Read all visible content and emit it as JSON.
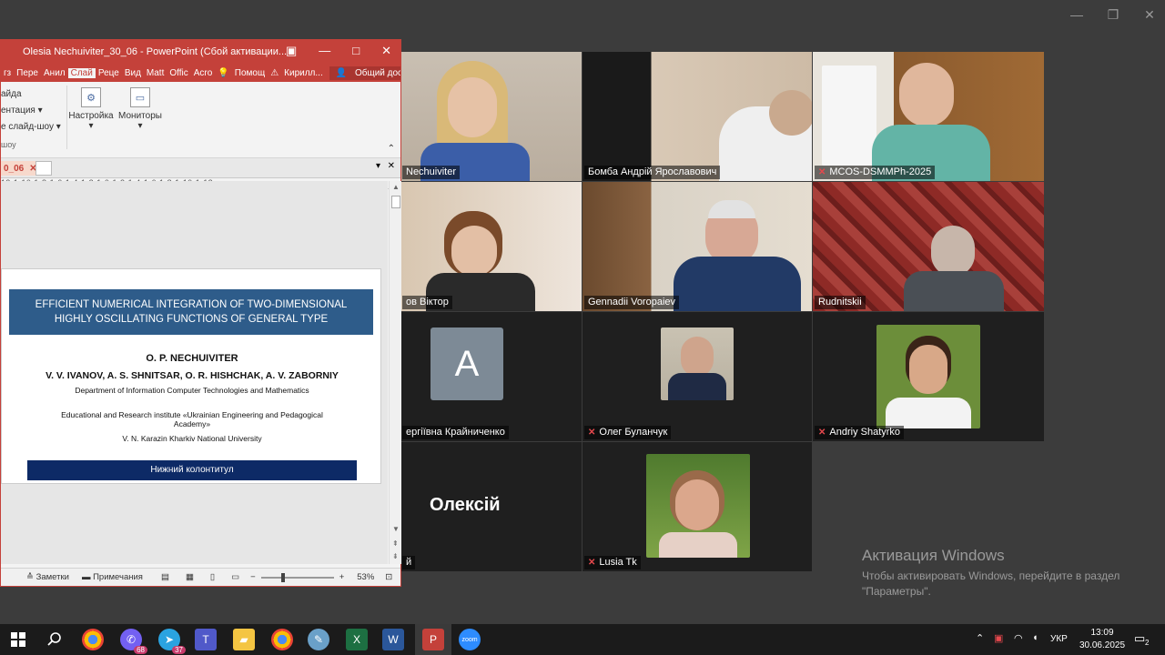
{
  "zoom_window": {
    "controls": [
      "—",
      "❐",
      "✕"
    ]
  },
  "participants": [
    {
      "id": "p1",
      "name": "Nechuiviter",
      "muted": false
    },
    {
      "id": "p2",
      "name": "Бомба Андрій Ярославович",
      "muted": false
    },
    {
      "id": "p3",
      "name": "MCOS-DSMMPh-2025",
      "muted": true
    },
    {
      "id": "p4",
      "name": "ов Віктор",
      "muted": false
    },
    {
      "id": "p5",
      "name": "Gennadii Voropaiev",
      "muted": false,
      "active_speaker": true
    },
    {
      "id": "p6",
      "name": "Rudnitskii",
      "muted": false
    },
    {
      "id": "p7",
      "name": "ергіївна Крайниченко",
      "muted": false,
      "avatar_letter": "A"
    },
    {
      "id": "p8",
      "name": "Олег Буланчук",
      "muted": true
    },
    {
      "id": "p9",
      "name": "Andriy Shatyrko",
      "muted": true
    },
    {
      "id": "p10",
      "name": "й",
      "muted": false,
      "display_name_big": "Олексій"
    },
    {
      "id": "p11",
      "name": "Lusia Tk",
      "muted": true
    }
  ],
  "powerpoint": {
    "title": "Olesia Nechuiviter_30_06 - PowerPoint (Сбой активации...",
    "tabs": [
      "гз",
      "Пере",
      "Анил",
      "Слай",
      "Реце",
      "Вид",
      "Matt",
      "Offic",
      "Acro"
    ],
    "selected_tab": "Слай",
    "help": "Помощ",
    "warning": "Кирилл...",
    "share": "Общий доступ",
    "ribbon": {
      "left_items": [
        "айда",
        "ентация",
        "е слайд-шоу"
      ],
      "group_label": "шоу",
      "setup": "Настройка",
      "monitors": "Мониторы"
    },
    "doc_tab": "0_06",
    "ruler": "12·1·10·1·8·1·6·1·4·1·2·1·0·1·2·1·4·1·6·1·8·1·10·1·12",
    "slide": {
      "title_line1": "EFFICIENT NUMERICAL INTEGRATION OF TWO-DIMENSIONAL",
      "title_line2": "HIGHLY OSCILLATING FUNCTIONS OF GENERAL TYPE",
      "author1": "O. P. NECHUIVITER",
      "authors2": "V. V. IVANOV, A. S. SHNITSAR, O. R. HISHCHAK, A. V. ZABORNIY",
      "dept": "Department of Information Computer Technologies and Mathematics",
      "inst_line1": "Educational and Research institute «Ukrainian Engineering and Pedagogical",
      "inst_line2": "Academy»",
      "university": "V. N. Karazin Kharkiv National University",
      "footer": "Нижний колонтитул"
    },
    "status": {
      "notes": "Заметки",
      "comments": "Примечания",
      "zoom": "53%"
    }
  },
  "activation": {
    "title": "Активация Windows",
    "line1": "Чтобы активировать Windows, перейдите в раздел",
    "line2": "\"Параметры\"."
  },
  "taskbar": {
    "badges": {
      "viber": "68",
      "telegram": "37"
    },
    "lang": "УКР",
    "time": "13:09",
    "date": "30.06.2025",
    "notifications": "2"
  }
}
